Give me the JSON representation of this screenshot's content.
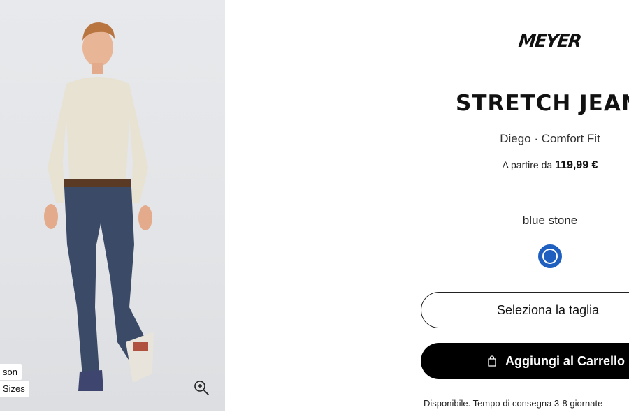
{
  "gallery": {
    "badges": {
      "season": "son",
      "sizes": "Sizes"
    },
    "zoom_icon": "zoom-in-icon"
  },
  "product": {
    "brand": "MEYER",
    "title": "STRETCH JEAN",
    "subtitle": "Diego · Comfort Fit",
    "price_prefix": "A partire da",
    "price": "119,99 €",
    "color_name": "blue stone",
    "swatch_color": "#1f5fbf"
  },
  "actions": {
    "select_size_label": "Seleziona la taglia",
    "add_to_cart_label": "Aggiungi al Carrello",
    "cart_icon": "shopping-bag-icon"
  },
  "availability": "Disponibile.  Tempo di consegna 3-8 giornate"
}
